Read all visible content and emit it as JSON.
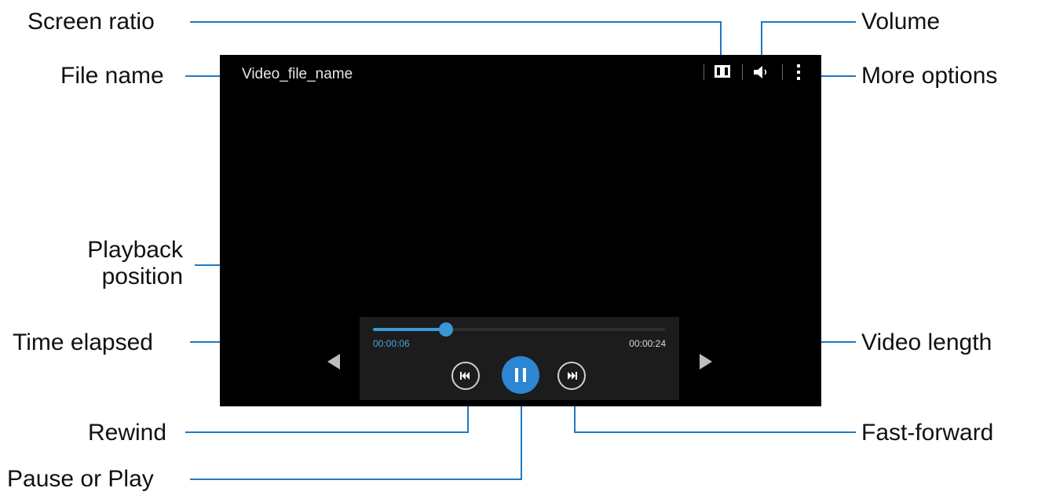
{
  "player": {
    "file_name": "Video_file_name",
    "time_elapsed": "00:00:06",
    "video_length": "00:00:24",
    "progress_fraction": 0.25,
    "accent_color": "#2c86d2",
    "icons": [
      "screen-ratio-icon",
      "volume-icon",
      "more-options-icon",
      "rewind-icon",
      "pause-icon",
      "fast-forward-icon",
      "previous-arrow-icon",
      "next-arrow-icon"
    ]
  },
  "callouts": {
    "screen_ratio": "Screen ratio",
    "file_name": "File name",
    "playback_position_line1": "Playback",
    "playback_position_line2": "position",
    "time_elapsed": "Time elapsed",
    "rewind": "Rewind",
    "pause_or_play": "Pause or Play",
    "volume": "Volume",
    "more_options": "More options",
    "video_length": "Video length",
    "fast_forward": "Fast-forward"
  }
}
